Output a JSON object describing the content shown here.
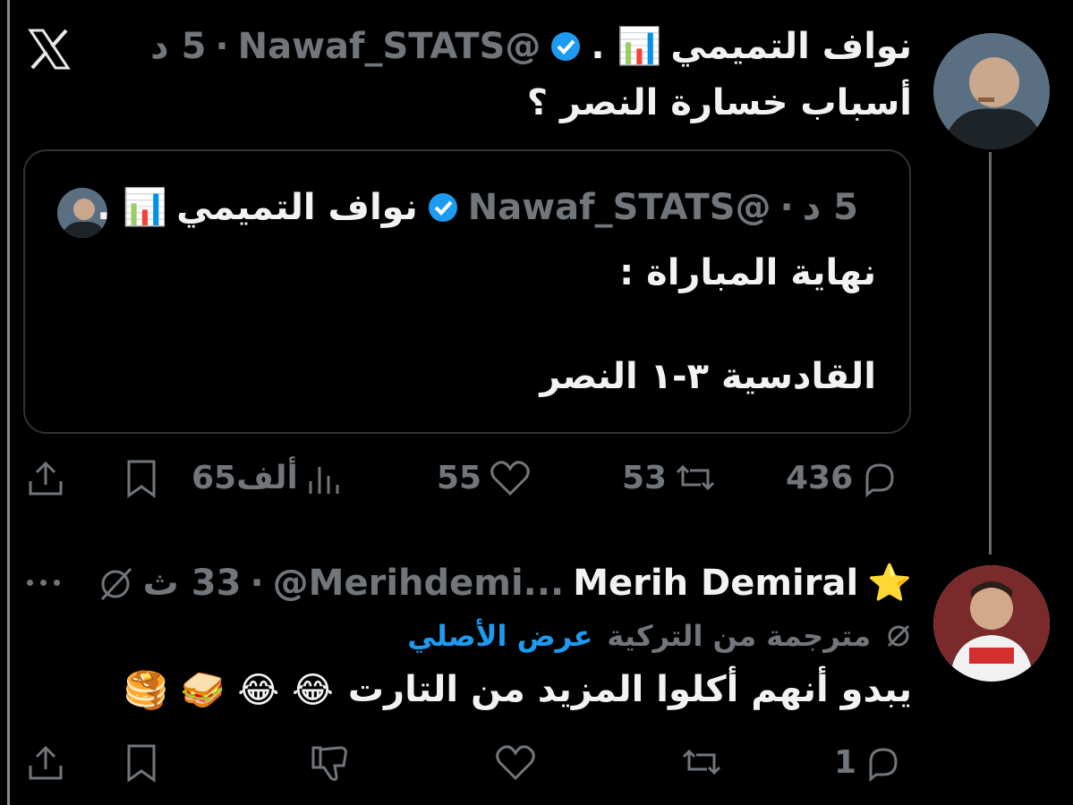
{
  "tweet": {
    "display_name": "نواف التميمي",
    "name_decor": "📊 .",
    "handle": "@Nawaf_STATS",
    "time": "5 د",
    "text": "أسباب خسارة النصر ؟",
    "quoted": {
      "display_name": "نواف التميمي",
      "name_decor": "📊 .",
      "handle": "@Nawaf_STATS",
      "time": "5 د",
      "line1": "نهاية المباراة :",
      "line2": "القادسية ٣-١ النصر"
    },
    "replies": "436",
    "retweets": "53",
    "likes": "55",
    "views": "65ألف"
  },
  "reply": {
    "display_name": "Merih Demiral",
    "star": "⭐",
    "handle": "@Merihdemi...",
    "time": "33 ث",
    "translated_note": "مترجمة من التركية",
    "view_original": "عرض الأصلي",
    "text": "يبدو أنهم أكلوا المزيد من التارت",
    "emojis": "😂 😂 🥪 🥞",
    "replies": "1"
  },
  "icons": {
    "x_logo": "x-logo-icon",
    "verified": "verified-badge-icon"
  },
  "colors": {
    "background": "#000000",
    "text": "#e7e9ea",
    "muted": "#71767b",
    "link": "#1d9bf0",
    "verified": "#1d9bf0"
  }
}
